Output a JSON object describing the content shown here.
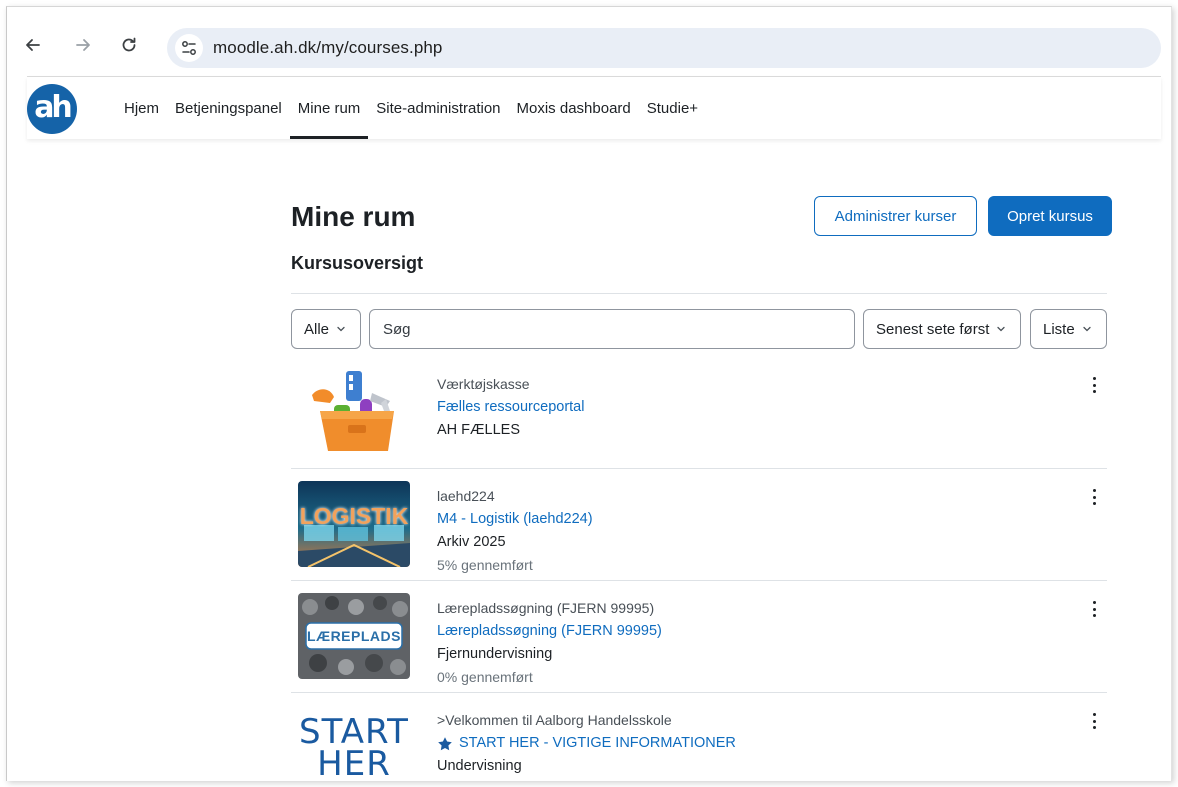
{
  "browser": {
    "url": "moodle.ah.dk/my/courses.php"
  },
  "navbar": {
    "logo_text": "ah",
    "items": [
      {
        "label": "Hjem"
      },
      {
        "label": "Betjeningspanel"
      },
      {
        "label": "Mine rum",
        "active": true
      },
      {
        "label": "Site-administration"
      },
      {
        "label": "Moxis dashboard"
      },
      {
        "label": "Studie+"
      }
    ]
  },
  "page": {
    "title": "Mine rum",
    "subtitle": "Kursusoversigt",
    "manage_button": "Administrer kurser",
    "create_button": "Opret kursus"
  },
  "filters": {
    "grouping": "Alle",
    "search_placeholder": "Søg",
    "sort": "Senest sete først",
    "view": "Liste"
  },
  "courses": [
    {
      "category": "Værktøjskasse",
      "name": "Fælles ressourceportal",
      "meta": "AH FÆLLES",
      "progress": "",
      "thumb": "toolbox"
    },
    {
      "category": "laehd224",
      "name": "M4 - Logistik (laehd224)",
      "meta": "Arkiv 2025",
      "progress": "5% gennemført",
      "thumb": "logistik",
      "thumb_text": "LOGISTIK"
    },
    {
      "category": "Lærepladssøgning (FJERN 99995)",
      "name": "Lærepladssøgning (FJERN 99995)",
      "meta": "Fjernundervisning",
      "progress": "0% gennemført",
      "thumb": "laereplads",
      "thumb_text": "LÆREPLADS"
    },
    {
      "category": ">Velkommen til Aalborg Handelsskole",
      "name": "START HER - VIGTIGE INFORMATIONER",
      "meta": "Undervisning",
      "progress": "",
      "thumb": "starther",
      "thumb_lines": [
        "START",
        "HER"
      ],
      "starred": true
    }
  ],
  "colors": {
    "brand": "#0f6cbf",
    "logo": "#1563a8",
    "text": "#1d2125"
  }
}
